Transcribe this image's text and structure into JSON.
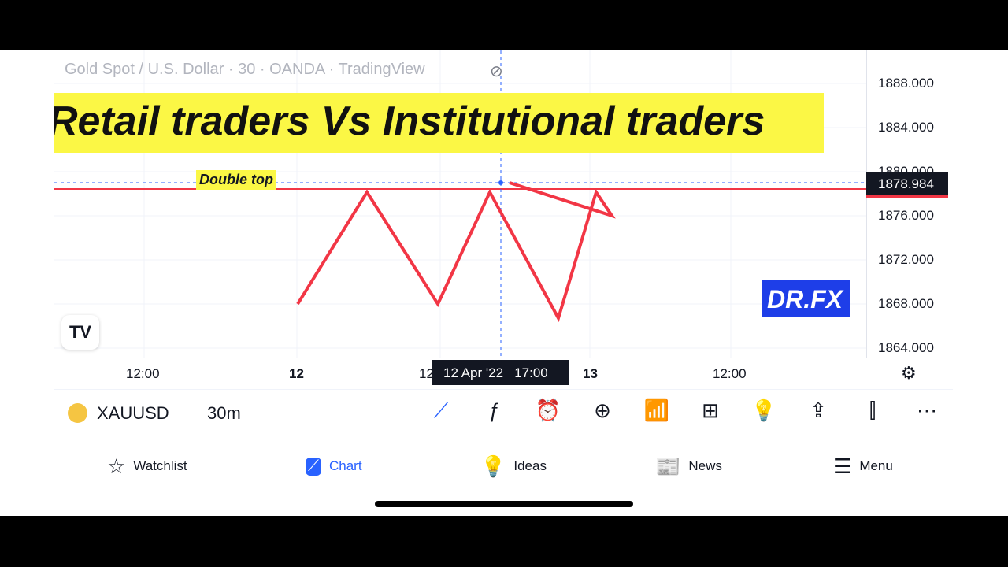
{
  "chart": {
    "legend": "Gold Spot / U.S. Dollar · 30 · OANDA · TradingView",
    "banner": "Retail traders Vs Institutional traders",
    "annotation": "Double top",
    "watermark": "DR.FX",
    "logo": "TV",
    "price_labels": [
      "1888.000",
      "1884.000",
      "1880.000",
      "1876.000",
      "1872.000",
      "1868.000",
      "1864.000"
    ],
    "current_price": "1878.984",
    "time_labels": [
      "12:00",
      "12",
      "12",
      "13",
      "12:00"
    ],
    "crosshair_time": "12 Apr '22   17:00",
    "colors": {
      "line": "#f23645",
      "banner": "#fbf745",
      "watermark": "#1e3ee8",
      "crosshair": "#2962ff"
    }
  },
  "toolbar": {
    "symbol": "XAUUSD",
    "interval": "30m",
    "icons": [
      "trend-line-icon",
      "indicators-icon",
      "alert-icon",
      "add-icon",
      "compare-icon",
      "layout-icon",
      "ideas-icon",
      "share-icon",
      "candles-icon",
      "more-icon"
    ]
  },
  "nav": [
    {
      "label": "Watchlist",
      "icon": "star-icon"
    },
    {
      "label": "Chart",
      "icon": "chart-icon"
    },
    {
      "label": "Ideas",
      "icon": "lightbulb-icon"
    },
    {
      "label": "News",
      "icon": "news-icon"
    },
    {
      "label": "Menu",
      "icon": "menu-icon"
    }
  ]
}
